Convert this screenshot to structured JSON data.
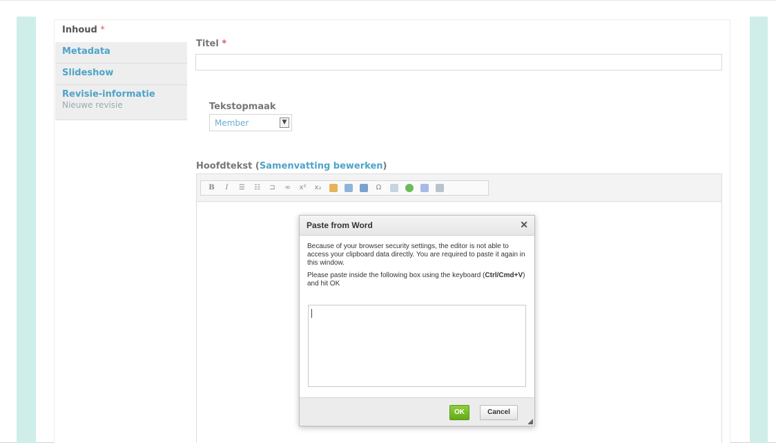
{
  "tabs": [
    {
      "label": "Inhoud",
      "required_mark": "*"
    },
    {
      "label": "Metadata"
    },
    {
      "label": "Slideshow"
    },
    {
      "label": "Revisie-informatie",
      "summary": "Nieuwe revisie"
    }
  ],
  "title_field": {
    "label": "Titel",
    "required_mark": "*",
    "value": ""
  },
  "text_format": {
    "label": "Tekstopmaak",
    "selected": "Member"
  },
  "body_field": {
    "label": "Hoofdtekst",
    "paren_open": "(",
    "summary_link": "Samenvatting bewerken",
    "paren_close": ")"
  },
  "toolbar": {
    "bold": "B",
    "italic": "I",
    "bullets": "☰",
    "numbered": "☷",
    "indent": "⊐",
    "link": "∞",
    "sup": "x²",
    "sub": "x₂",
    "omega": "Ω"
  },
  "dialog": {
    "title": "Paste from Word",
    "close": "✕",
    "message": "Because of your browser security settings, the editor is not able to access your clipboard data directly. You are required to paste it again in this window.",
    "instruction_prefix": "Please paste inside the following box using the keyboard (",
    "instruction_shortcut": "Ctrl/Cmd+V",
    "instruction_suffix": ") and hit OK",
    "ok_label": "OK",
    "cancel_label": "Cancel"
  },
  "colors": {
    "accent_link": "#4ea3c8",
    "required": "#e05a5a",
    "ok_green": "#6fb623",
    "side_band": "#cfeee9"
  }
}
